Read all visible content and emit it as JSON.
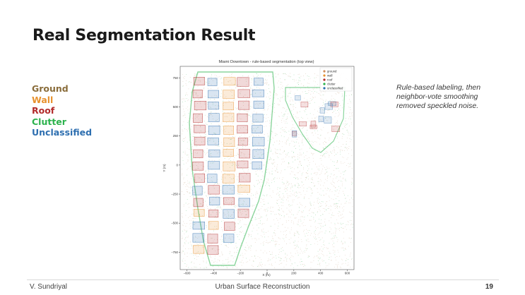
{
  "slide": {
    "title": "Real Segmentation Result",
    "legend": [
      {
        "label": "Ground",
        "color": "#8a6d3b"
      },
      {
        "label": "Wall",
        "color": "#e8922e"
      },
      {
        "label": "Roof",
        "color": "#b22a2a"
      },
      {
        "label": "Clutter",
        "color": "#2bb24c"
      },
      {
        "label": "Unclassified",
        "color": "#2e6fb0"
      }
    ],
    "note": "Rule-based labeling, then neighbor-vote smoothing removed speckled noise."
  },
  "footer": {
    "author": "V. Sundriyal",
    "center": "Urban Surface Reconstruction",
    "page": "19"
  },
  "chart_data": {
    "type": "scatter",
    "title": "Miami Downtown - rule-based segmentation (top view)",
    "xlabel": "X (m)",
    "ylabel": "Y (m)",
    "xlim": [
      -650,
      650
    ],
    "ylim": [
      -900,
      850
    ],
    "xticks": [
      -600,
      -400,
      -200,
      0,
      200,
      400,
      600
    ],
    "yticks": [
      750,
      500,
      250,
      0,
      -250,
      -500,
      -750
    ],
    "xtick_labels": [
      "−600",
      "−400",
      "−200",
      "0",
      "200",
      "400",
      "600"
    ],
    "ytick_labels": [
      "750",
      "500",
      "250",
      "0",
      "−250",
      "−500",
      "−750"
    ],
    "series": [
      {
        "name": "ground",
        "color": "#c9a98a"
      },
      {
        "name": "wall",
        "color": "#e8922e"
      },
      {
        "name": "roof",
        "color": "#b22a2a"
      },
      {
        "name": "clutter",
        "color": "#2bb24c"
      },
      {
        "name": "unclassified",
        "color": "#2e6fb0"
      }
    ],
    "legend_position": "top-right",
    "grid": false
  }
}
